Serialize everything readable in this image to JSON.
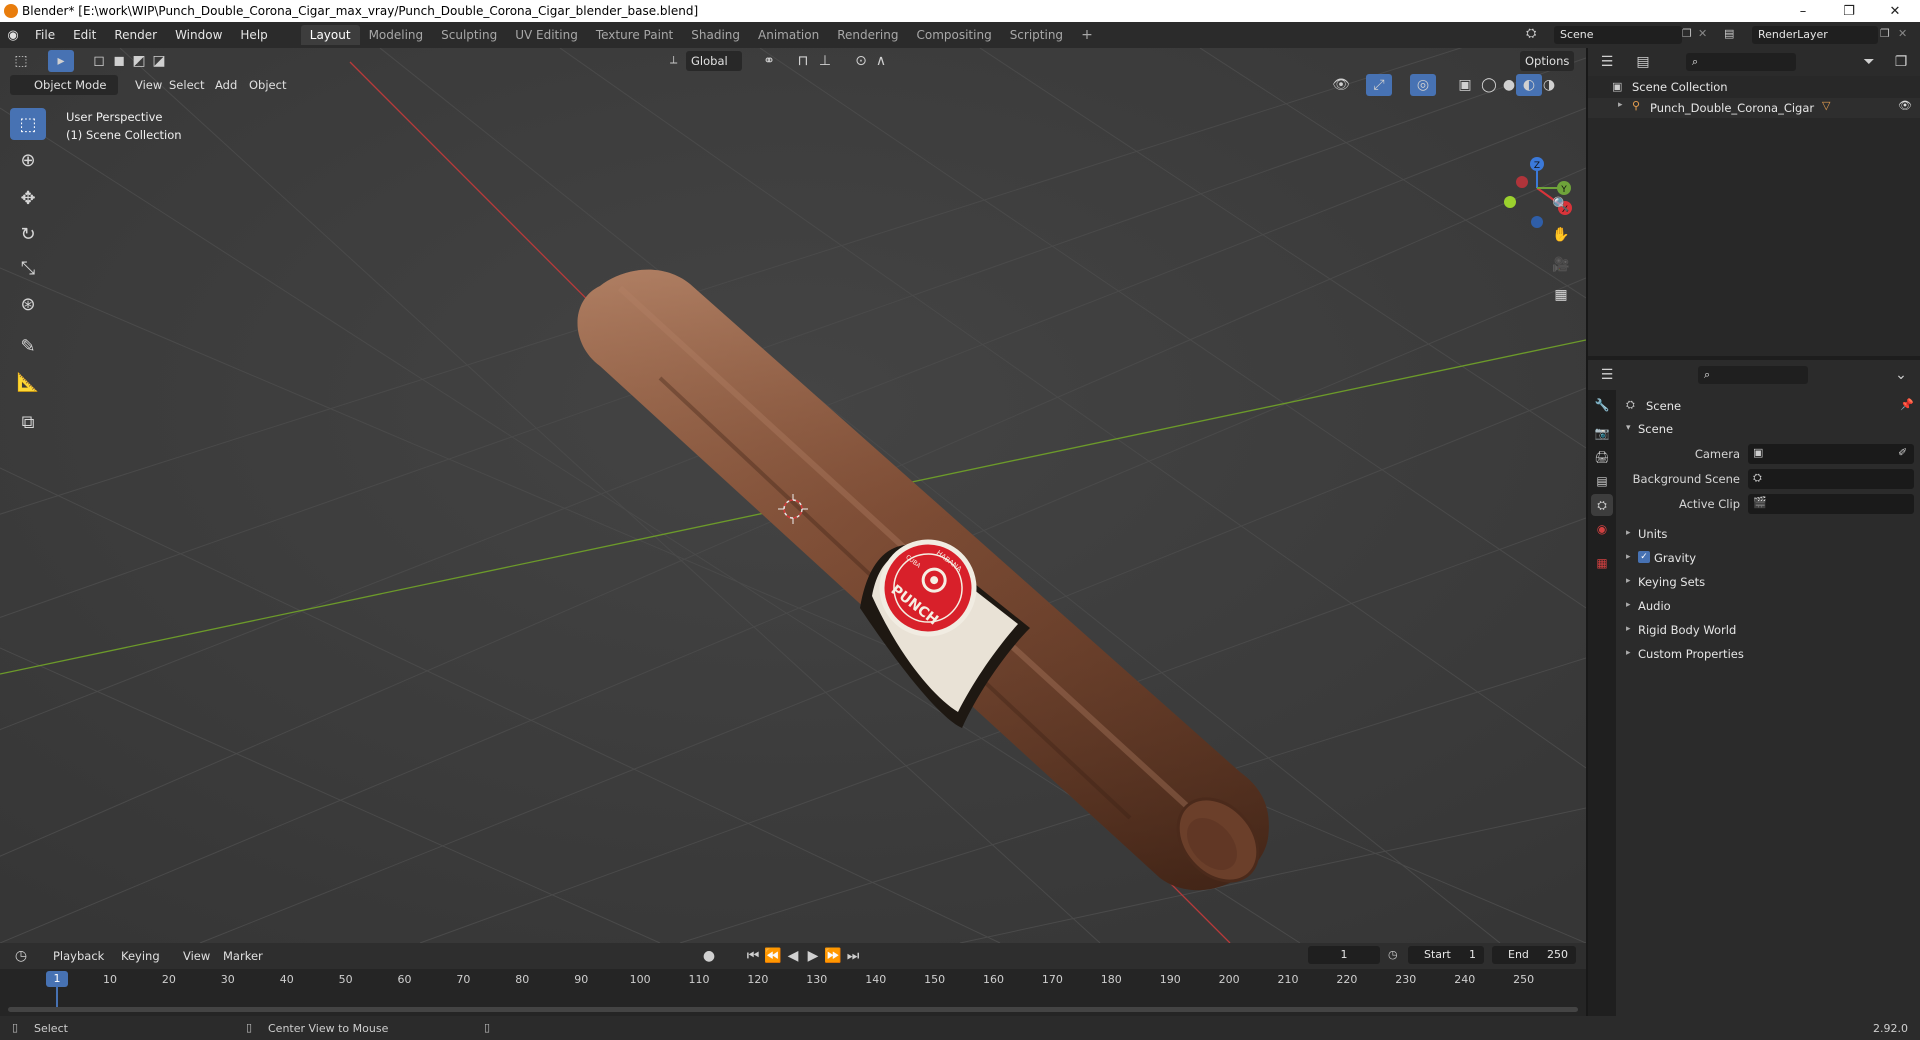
{
  "window": {
    "title": "Blender* [E:\\work\\WIP\\Punch_Double_Corona_Cigar_max_vray/Punch_Double_Corona_Cigar_blender_base.blend]",
    "minimize": "–",
    "maximize": "❐",
    "close": "✕"
  },
  "menu": {
    "items": [
      "File",
      "Edit",
      "Render",
      "Window",
      "Help"
    ]
  },
  "workspaces": [
    "Layout",
    "Modeling",
    "Sculpting",
    "UV Editing",
    "Texture Paint",
    "Shading",
    "Animation",
    "Rendering",
    "Compositing",
    "Scripting"
  ],
  "active_workspace": "Layout",
  "add_workspace": "+",
  "scene_selector": "Scene",
  "render_layer": "RenderLayer",
  "viewport": {
    "transform_orientation": "Global",
    "options": "Options",
    "mode": "Object Mode",
    "header_menus": [
      "View",
      "Select",
      "Add",
      "Object"
    ],
    "overlay_line1": "User Perspective",
    "overlay_line2": "(1) Scene Collection",
    "gizmo": {
      "x": "X",
      "y": "Y",
      "z": "Z"
    },
    "object": "Punch_Double_Corona_Cigar",
    "label_text": "PUNCH",
    "label_sub1": "HABANA",
    "label_sub2": "CUBA"
  },
  "outliner": {
    "root": "Scene Collection",
    "items": [
      {
        "label": "Punch_Double_Corona_Cigar"
      }
    ]
  },
  "properties": {
    "header": "Scene",
    "panel": "Scene",
    "camera_label": "Camera",
    "background_label": "Background Scene",
    "clip_label": "Active Clip",
    "subpanels": [
      "Units",
      "Gravity",
      "Keying Sets",
      "Audio",
      "Rigid Body World",
      "Custom Properties"
    ],
    "gravity_checked": true
  },
  "timeline": {
    "menus": [
      "Playback",
      "Keying",
      "View",
      "Marker"
    ],
    "current_frame": "1",
    "start_label": "Start",
    "start": "1",
    "end_label": "End",
    "end": "250",
    "ticks": [
      "1",
      "10",
      "20",
      "30",
      "40",
      "50",
      "60",
      "70",
      "80",
      "90",
      "100",
      "110",
      "120",
      "130",
      "140",
      "150",
      "160",
      "170",
      "180",
      "190",
      "200",
      "210",
      "220",
      "230",
      "240",
      "250"
    ]
  },
  "status": {
    "left": "Select",
    "middle": "Center View to Mouse",
    "version": "2.92.0"
  },
  "colors": {
    "accent": "#4772b3",
    "x_axis": "#c03a3a",
    "y_axis": "#6b9a2a",
    "cigar": "#7a4a33",
    "label_red": "#d8202a"
  }
}
